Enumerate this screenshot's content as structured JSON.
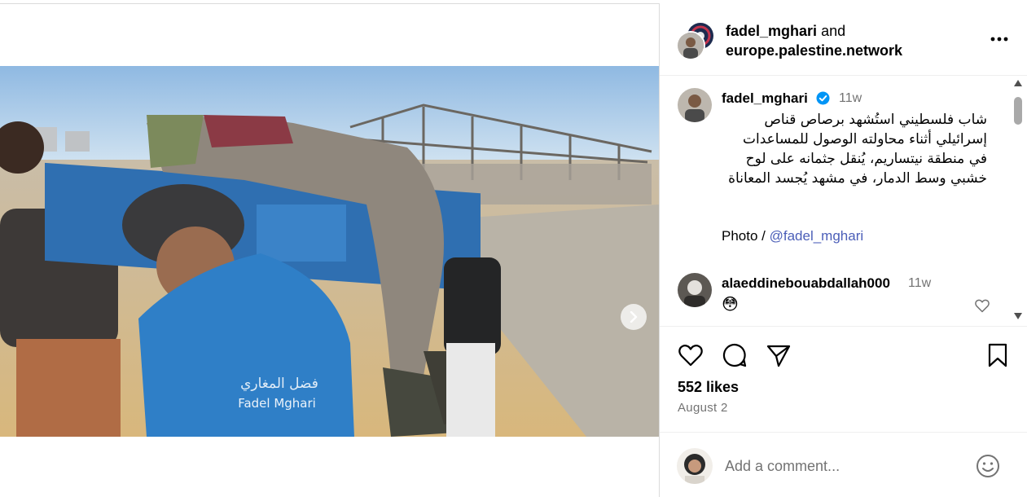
{
  "post": {
    "header": {
      "author": "fadel_mghari",
      "connector": "and",
      "collaborator": "europe.palestine.network"
    },
    "media": {
      "watermark_arabic": "فضل المغاري",
      "watermark_latin": "Fadel  Mghari",
      "carousel_total": 5,
      "carousel_active_index": 0
    },
    "caption": {
      "username": "fadel_mghari",
      "time": "11w",
      "text": "شاب فلسطيني استُشهد برصاص قناص إسرائيلي أثناء محاولته الوصول للمساعدات في منطقة نيتساريم، يُنقل جثمانه على لوح خشبي وسط الدمار، في مشهد يُجسد المعاناة",
      "photo_prefix": "Photo / ",
      "photo_credit": "@fadel_mghari"
    },
    "comments": [
      {
        "username": "alaeddinebouabdallah000",
        "time": "11w",
        "text": "😳"
      }
    ],
    "likes_text": "552 likes",
    "date_text": "August 2",
    "add_comment_placeholder": "Add a comment..."
  },
  "colors": {
    "link": "#4b5eb8",
    "muted": "#737373",
    "verified": "#0095f6",
    "border": "#dbdbdb"
  },
  "icons": [
    "ellipsis-icon",
    "verified-icon",
    "heart-icon",
    "comment-icon",
    "share-icon",
    "bookmark-icon",
    "emoji-icon",
    "chevron-right-icon",
    "user-tag-icon"
  ]
}
